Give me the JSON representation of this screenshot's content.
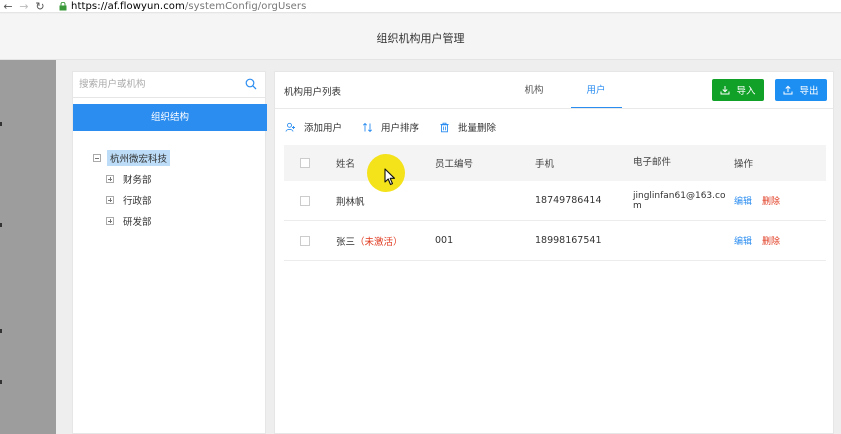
{
  "browser": {
    "back_icon": "arrow-left-icon",
    "forward_icon": "arrow-right-icon",
    "reload_icon": "reload-icon",
    "url_host": "https://af.flowyun.com",
    "url_path": "/systemConfig/orgUsers"
  },
  "header": {
    "title": "组织机构用户管理"
  },
  "org": {
    "search_placeholder": "搜索用户或机构",
    "structure_button": "组织结构",
    "root": "杭州微宏科技",
    "children": [
      "财务部",
      "行政部",
      "研发部"
    ]
  },
  "list": {
    "title": "机构用户列表",
    "tabs": [
      {
        "label": "机构",
        "active": false
      },
      {
        "label": "用户",
        "active": true
      }
    ],
    "import_label": "导入",
    "export_label": "导出",
    "actions": {
      "add_user": "添加用户",
      "sort_users": "用户排序",
      "batch_delete": "批量删除"
    },
    "columns": {
      "name": "姓名",
      "employee_no": "员工编号",
      "phone": "手机",
      "email": "电子邮件",
      "operation": "操作"
    },
    "rows": [
      {
        "name": "荆林帆",
        "status": "",
        "employee_no": "",
        "phone": "18749786414",
        "email": "jinglinfan61@163.com",
        "edit": "编辑",
        "delete": "删除"
      },
      {
        "name": "张三",
        "status": "（未激活）",
        "employee_no": "001",
        "phone": "18998167541",
        "email": "",
        "edit": "编辑",
        "delete": "删除"
      }
    ]
  },
  "colors": {
    "accent": "#2b8df0",
    "import_green": "#12a128",
    "danger": "#e0391f",
    "cursor_highlight": "#f4e21a"
  }
}
